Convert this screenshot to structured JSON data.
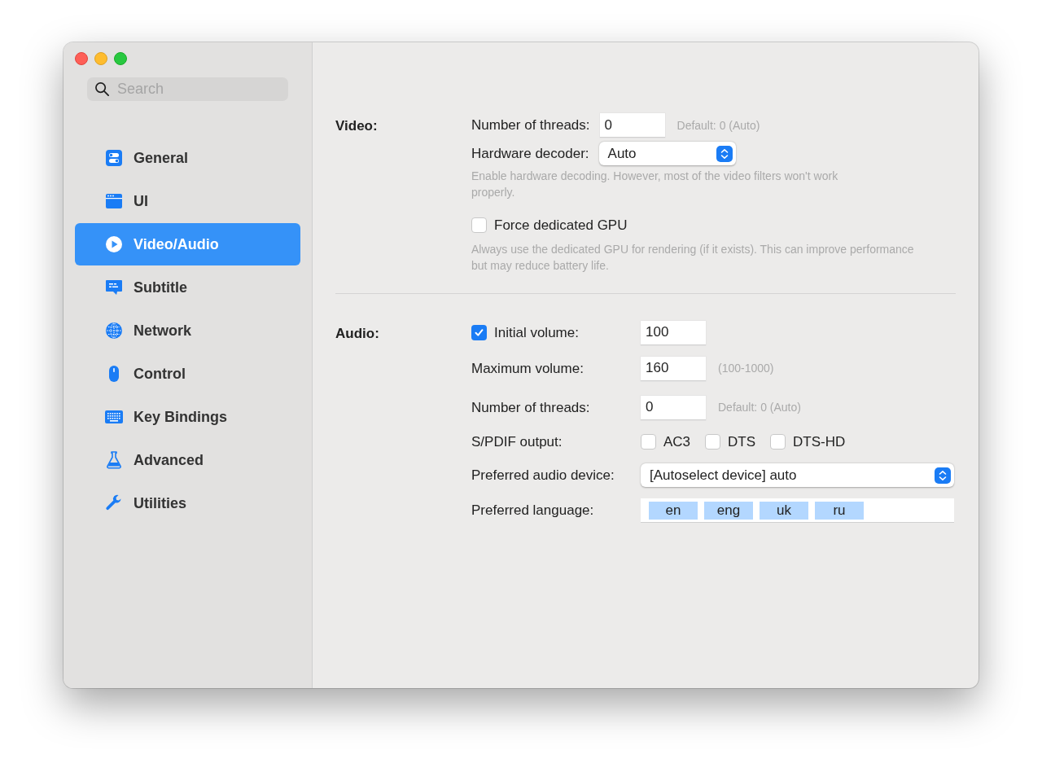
{
  "search": {
    "placeholder": "Search"
  },
  "sidebar": {
    "items": [
      {
        "label": "General",
        "selected": false
      },
      {
        "label": "UI",
        "selected": false
      },
      {
        "label": "Video/Audio",
        "selected": true
      },
      {
        "label": "Subtitle",
        "selected": false
      },
      {
        "label": "Network",
        "selected": false
      },
      {
        "label": "Control",
        "selected": false
      },
      {
        "label": "Key Bindings",
        "selected": false
      },
      {
        "label": "Advanced",
        "selected": false
      },
      {
        "label": "Utilities",
        "selected": false
      }
    ]
  },
  "video": {
    "title": "Video:",
    "threads": {
      "label": "Number of threads:",
      "value": "0",
      "hint": "Default: 0 (Auto)"
    },
    "decoder": {
      "label": "Hardware decoder:",
      "value": "Auto"
    },
    "decoder_note": "Enable hardware decoding. However, most of the video filters won't work properly.",
    "force_gpu": {
      "label": "Force dedicated GPU",
      "checked": false
    },
    "gpu_note": "Always use the dedicated GPU for rendering (if it exists). This can improve performance but may reduce battery life."
  },
  "audio": {
    "title": "Audio:",
    "rows": [
      {
        "kind": "field",
        "label": "Initial volume:",
        "checked": true,
        "value": "100"
      },
      {
        "kind": "field",
        "label": "Maximum volume:",
        "value": "160",
        "hint": "(100-1000)"
      },
      {
        "kind": "field",
        "label": "Number of threads:",
        "value": "0",
        "hint": "Default: 0 (Auto)"
      },
      {
        "kind": "checkboxes",
        "label": "S/PDIF output:",
        "options": [
          {
            "label": "AC3",
            "checked": false
          },
          {
            "label": "DTS",
            "checked": false
          },
          {
            "label": "DTS-HD",
            "checked": false
          }
        ]
      },
      {
        "kind": "select",
        "label": "Preferred audio device:",
        "value": "[Autoselect device] auto"
      },
      {
        "kind": "tags",
        "label": "Preferred language:",
        "tags": [
          "en",
          "eng",
          "uk",
          "ru"
        ]
      }
    ]
  }
}
